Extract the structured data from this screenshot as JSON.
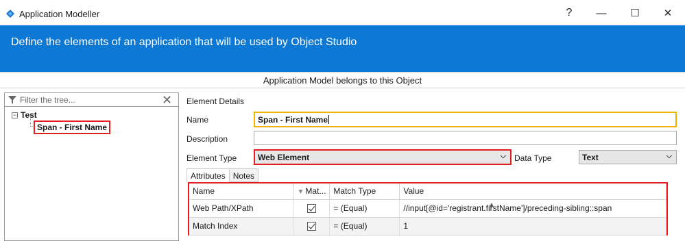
{
  "window": {
    "title": "Application Modeller",
    "help_label": "?",
    "minimize_label": "—",
    "maximize_label": "☐",
    "close_label": "✕"
  },
  "banner": {
    "text": "Define the elements of an application that will be used by Object Studio",
    "color": "#0e78d5"
  },
  "owner_bar": {
    "text": "Application Model belongs to this Object"
  },
  "tree": {
    "filter_placeholder": "Filter the tree...",
    "root": {
      "label": "Test",
      "toggle": "−"
    },
    "children": [
      {
        "label": "Span - First Name",
        "selected": true
      }
    ]
  },
  "details": {
    "section_label": "Element Details",
    "name_label": "Name",
    "name_value": "Span - First Name",
    "description_label": "Description",
    "description_value": "",
    "element_type_label": "Element Type",
    "element_type_value": "Web Element",
    "data_type_label": "Data Type",
    "data_type_value": "Text"
  },
  "tabs": [
    {
      "label": "Attributes",
      "active": true
    },
    {
      "label": "Notes",
      "active": false
    }
  ],
  "attributes_grid": {
    "columns": [
      "Name",
      "Mat...",
      "Match Type",
      "Value"
    ],
    "rows": [
      {
        "name": "Web Path/XPath",
        "match": true,
        "match_type": "=  (Equal)",
        "value": "//input[@id='registrant.firstName']/preceding-sibling::span"
      },
      {
        "name": "Match Index",
        "match": true,
        "match_type": "=  (Equal)",
        "value": "1"
      }
    ]
  },
  "colors": {
    "highlight_red": "#e01e1e",
    "focus_yellow": "#f0b400"
  }
}
